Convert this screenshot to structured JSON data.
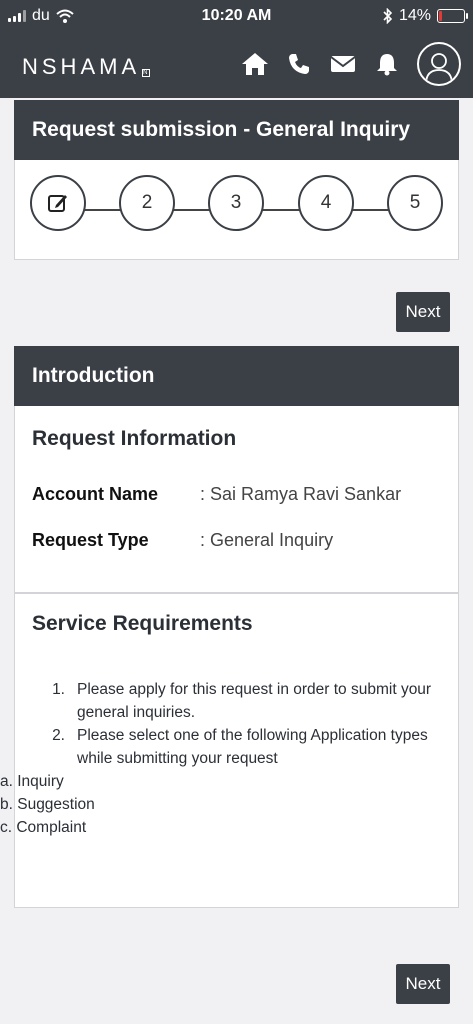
{
  "status_bar": {
    "carrier": "du",
    "time": "10:20 AM",
    "battery_percent": "14%",
    "battery_level": 0.14
  },
  "header": {
    "brand": "NSHAMA",
    "brand_mark": "N"
  },
  "request_card": {
    "title": "Request submission - General Inquiry",
    "steps": [
      "2",
      "3",
      "4",
      "5"
    ],
    "current_step": 1
  },
  "buttons": {
    "next_top": "Next",
    "next_bottom": "Next"
  },
  "introduction": {
    "title": "Introduction"
  },
  "request_info": {
    "title": "Request Information",
    "account_label": "Account Name",
    "account_value": ": Sai Ramya Ravi Sankar",
    "type_label": "Request Type",
    "type_value": ": General Inquiry"
  },
  "service_requirements": {
    "title": "Service Requirements",
    "items": [
      {
        "num": "1.",
        "text_line1": "Please apply for this request in order to submit your",
        "text_line2": "general inquiries."
      },
      {
        "num": "2.",
        "text_line1": "Please select one of the following Application types",
        "text_line2": "while submitting your request"
      }
    ],
    "options": [
      "a. Inquiry",
      "b. Suggestion",
      "c. Complaint"
    ]
  },
  "colors": {
    "header_bg": "#3b3f46",
    "battery_low": "#e53935"
  }
}
